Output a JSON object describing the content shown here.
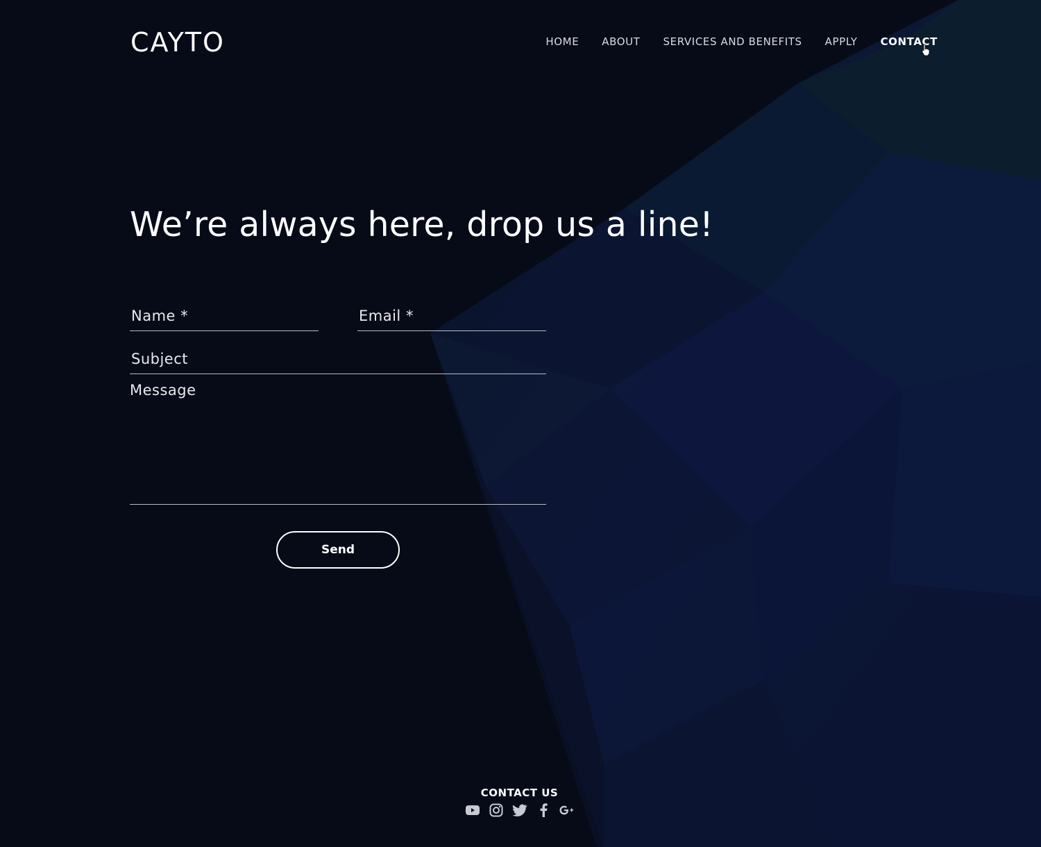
{
  "brand": {
    "logo_text": "CAYTO"
  },
  "nav": {
    "items": [
      {
        "label": "HOME"
      },
      {
        "label": "ABOUT"
      },
      {
        "label": "SERVICES AND BENEFITS"
      },
      {
        "label": "APPLY"
      },
      {
        "label": "CONTACT"
      }
    ],
    "active": "CONTACT"
  },
  "hero": {
    "headline": "We’re always here, drop us a line!"
  },
  "form": {
    "name_label": "Name *",
    "email_label": "Email *",
    "subject_label": "Subject",
    "message_label": "Message",
    "send_label": "Send"
  },
  "footer": {
    "title": "CONTACT US",
    "social": [
      "youtube-icon",
      "instagram-icon",
      "twitter-icon",
      "facebook-icon",
      "google-plus-icon"
    ]
  },
  "colors": {
    "background": "#070b17",
    "accent_polygons": "#0e1a3c",
    "text": "#ffffff"
  }
}
